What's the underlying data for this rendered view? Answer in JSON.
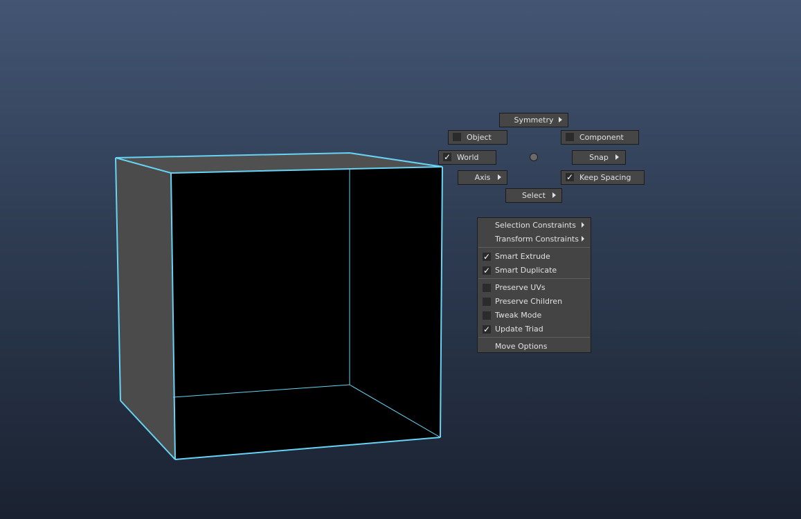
{
  "marking_menu": {
    "symmetry": "Symmetry",
    "object": {
      "label": "Object",
      "checked": false
    },
    "component": {
      "label": "Component",
      "checked": false
    },
    "world": {
      "label": "World",
      "checked": true
    },
    "snap": "Snap",
    "axis": "Axis",
    "keep_spacing": {
      "label": "Keep Spacing",
      "checked": true
    },
    "select": "Select"
  },
  "options_menu": {
    "items": [
      {
        "label": "Selection Constraints",
        "submenu": true
      },
      {
        "label": "Transform Constraints",
        "submenu": true
      },
      {
        "label": "Smart Extrude",
        "checked": true
      },
      {
        "label": "Smart Duplicate",
        "checked": true
      },
      {
        "label": "Preserve UVs",
        "checked": false
      },
      {
        "label": "Preserve Children",
        "checked": false
      },
      {
        "label": "Tweak Mode",
        "checked": false
      },
      {
        "label": "Update Triad",
        "checked": true
      },
      {
        "label": "Move Options"
      }
    ]
  },
  "colors": {
    "background_top": "#435573",
    "background_bottom": "#1a2231",
    "selection_highlight": "#67d4f5",
    "face_grey": "#505050",
    "face_black": "#000000"
  }
}
